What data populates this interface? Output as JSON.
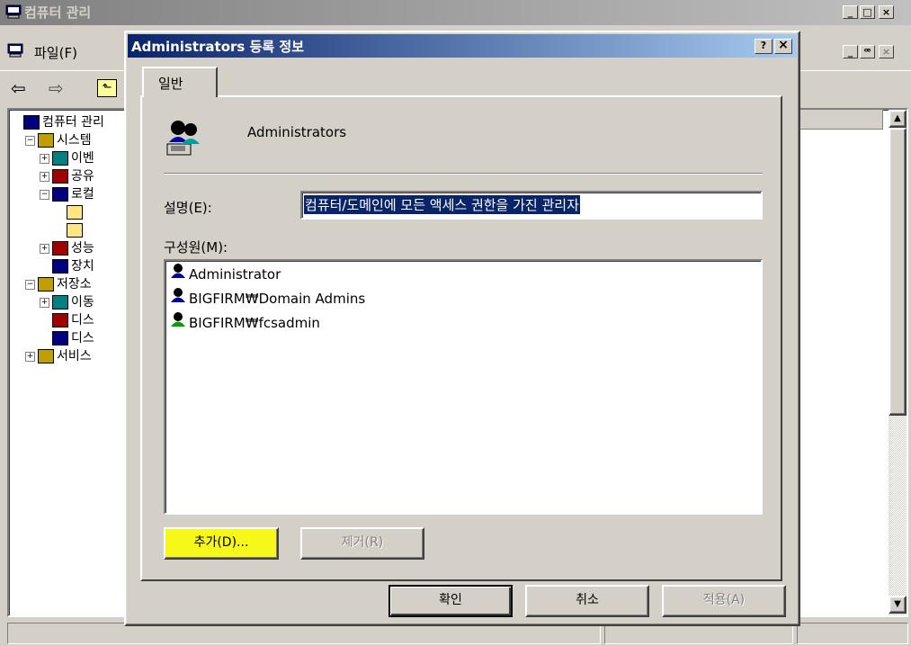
{
  "main_window": {
    "title": "컴퓨터 관리",
    "menu": {
      "file": "파일(F)"
    },
    "tree": [
      {
        "label": "컴퓨터 관리",
        "indent": 0
      },
      {
        "label": "시스템",
        "indent": 1
      },
      {
        "label": "이벤",
        "indent": 2
      },
      {
        "label": "공유",
        "indent": 2
      },
      {
        "label": "로컬",
        "indent": 2
      },
      {
        "label": "",
        "indent": 3
      },
      {
        "label": "",
        "indent": 3
      },
      {
        "label": "성능",
        "indent": 2
      },
      {
        "label": "장치",
        "indent": 2
      },
      {
        "label": "저장소",
        "indent": 1
      },
      {
        "label": "이동",
        "indent": 2
      },
      {
        "label": "디스",
        "indent": 2
      },
      {
        "label": "디스",
        "indent": 2
      },
      {
        "label": "서비스",
        "indent": 1
      }
    ]
  },
  "dialog": {
    "title": "Administrators 등록 정보",
    "help_button": "?",
    "close_button": "×",
    "tab": "일반",
    "group_name": "Administrators",
    "description_label": "설명(E):",
    "description_value": "컴퓨터/도메인에 모든 액세스 권한을 가진 관리자",
    "members_label": "구성원(M):",
    "members": [
      "Administrator",
      "BIGFIRM₩Domain Admins",
      "BIGFIRM₩fcsadmin"
    ],
    "add_button": "추가(D)...",
    "remove_button": "제거(R)",
    "ok_button": "확인",
    "cancel_button": "취소",
    "apply_button": "적용(A)"
  },
  "colors": {
    "title_active": "#0a246a",
    "title_inactive": "#808080",
    "highlight": "#f7f71a"
  }
}
